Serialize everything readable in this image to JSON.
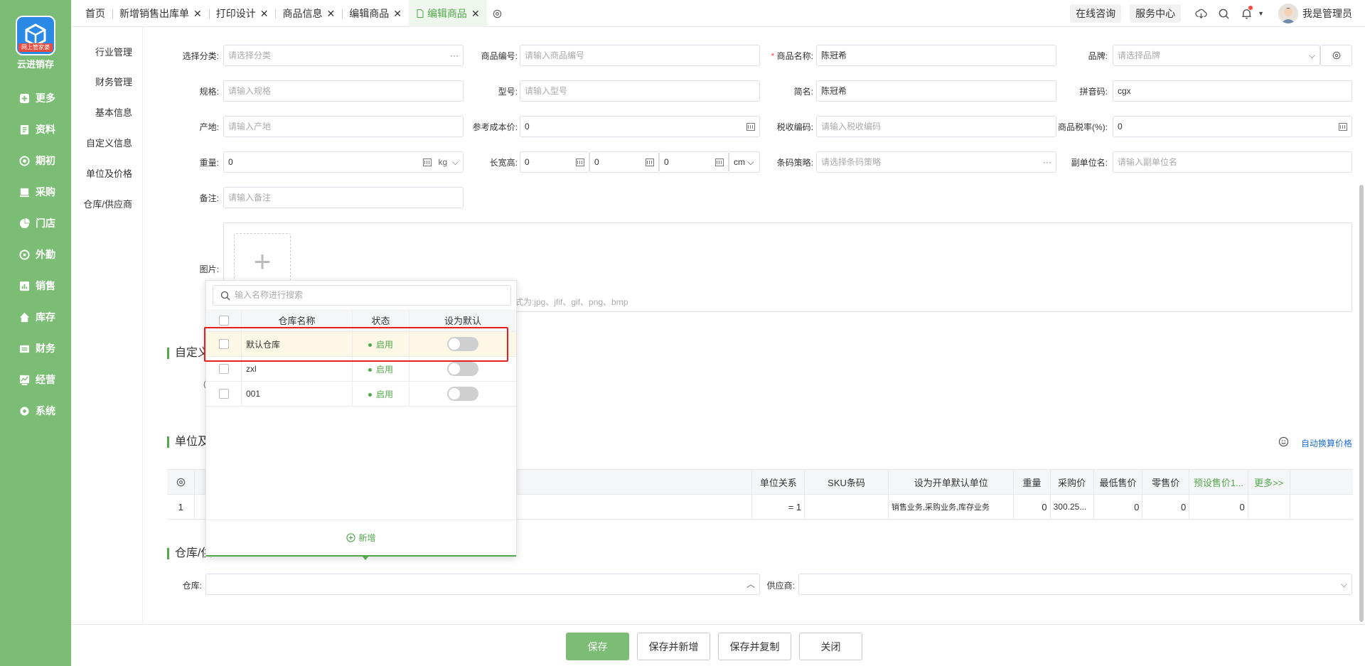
{
  "app": {
    "name": "云进销存",
    "logo_tag": "网上管家婆"
  },
  "sidebar": {
    "items": [
      {
        "label": "更多",
        "icon": "plus-square-icon"
      },
      {
        "label": "资料",
        "icon": "book-icon"
      },
      {
        "label": "期初",
        "icon": "clock-icon"
      },
      {
        "label": "采购",
        "icon": "cart-icon"
      },
      {
        "label": "门店",
        "icon": "pie-icon"
      },
      {
        "label": "外勤",
        "icon": "target-icon"
      },
      {
        "label": "销售",
        "icon": "chart-icon"
      },
      {
        "label": "库存",
        "icon": "house-icon"
      },
      {
        "label": "财务",
        "icon": "wallet-icon"
      },
      {
        "label": "经营",
        "icon": "trend-icon"
      },
      {
        "label": "系统",
        "icon": "gear-icon"
      }
    ]
  },
  "tabs": [
    {
      "label": "首页",
      "closable": false
    },
    {
      "label": "新增销售出库单",
      "closable": true
    },
    {
      "label": "打印设计",
      "closable": true
    },
    {
      "label": "商品信息",
      "closable": true
    },
    {
      "label": "编辑商品",
      "closable": true
    },
    {
      "label": "编辑商品",
      "closable": true,
      "active": true
    }
  ],
  "topbar": {
    "online": "在线咨询",
    "service": "服务中心",
    "user": "我是管理员"
  },
  "anchors": [
    "行业管理",
    "财务管理",
    "基本信息",
    "自定义信息",
    "单位及价格",
    "仓库/供应商"
  ],
  "form": {
    "category": {
      "label": "选择分类:",
      "placeholder": "请选择分类"
    },
    "code": {
      "label": "商品编号:",
      "placeholder": "请输入商品编号"
    },
    "name": {
      "label": "商品名称:",
      "value": "陈冠希"
    },
    "brand": {
      "label": "品牌:",
      "placeholder": "请选择品牌"
    },
    "spec": {
      "label": "规格:",
      "placeholder": "请输入规格"
    },
    "model": {
      "label": "型号:",
      "placeholder": "请输入型号"
    },
    "short": {
      "label": "简名:",
      "value": "陈冠希"
    },
    "pinyin": {
      "label": "拼音码:",
      "value": "cgx"
    },
    "origin": {
      "label": "产地:",
      "placeholder": "请输入产地"
    },
    "cost": {
      "label": "参考成本价:",
      "value": "0"
    },
    "taxcode": {
      "label": "税收编码:",
      "placeholder": "请输入税收编码"
    },
    "taxrate": {
      "label": "商品税率(%):",
      "value": "0"
    },
    "weight": {
      "label": "重量:",
      "value": "0",
      "unit": "kg"
    },
    "dims": {
      "label": "长宽高:",
      "l": "0",
      "w": "0",
      "h": "0",
      "unit": "cm"
    },
    "barcode": {
      "label": "条码策略:",
      "placeholder": "请选择条码策略"
    },
    "subunit": {
      "label": "副单位名:",
      "placeholder": "请输入副单位名"
    },
    "remark": {
      "label": "备注:",
      "placeholder": "请输入备注"
    },
    "image": {
      "label": "图片:",
      "hint": "式为:jpg、jfif、gif、png、bmp"
    }
  },
  "sections": {
    "custom": "自定义",
    "units": "单位及",
    "warehouse": "仓库/供",
    "auto_price": "自动换算价格"
  },
  "units_table": {
    "columns": [
      "单位关系",
      "SKU条码",
      "设为开单默认单位",
      "重量",
      "采购价",
      "最低售价",
      "零售价",
      "预设售价1...",
      "更多>>"
    ],
    "rows": [
      {
        "no": "1",
        "relation": "= 1",
        "sku": "",
        "default_unit": "销售业务,采购业务,库存业务",
        "weight": "0",
        "purchase": "300.25...",
        "min_price": "0",
        "retail": "0",
        "preset": "0"
      }
    ]
  },
  "warehouse_field": {
    "label": "仓库:",
    "supplier_label": "供应商:"
  },
  "popup": {
    "search_placeholder": "输入名称进行搜索",
    "headers": [
      "仓库名称",
      "状态",
      "设为默认"
    ],
    "rows": [
      {
        "name": "默认仓库",
        "status": "启用",
        "default": false
      },
      {
        "name": "zxl",
        "status": "启用",
        "default": false
      },
      {
        "name": "001",
        "status": "启用",
        "default": false
      }
    ],
    "add_label": "新增"
  },
  "buttons": {
    "save": "保存",
    "save_new": "保存并新增",
    "save_copy": "保存并复制",
    "close": "关闭"
  },
  "colors": {
    "brand_green": "#7cbd75",
    "accent_green": "#52a84a",
    "highlight_red": "#e62020"
  }
}
